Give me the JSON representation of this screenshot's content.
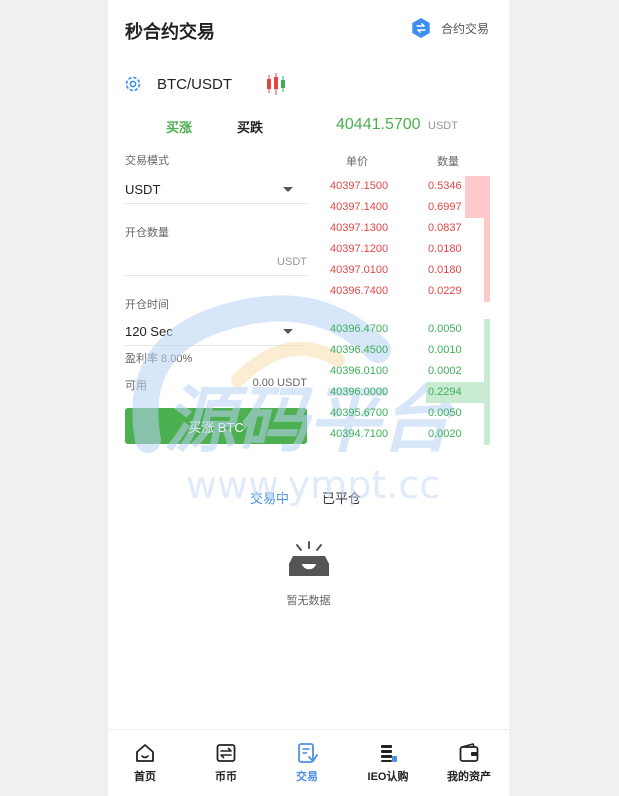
{
  "header": {
    "title": "秒合约交易",
    "contract_link": "合约交易"
  },
  "pair": {
    "name": "BTC/USDT"
  },
  "trade": {
    "tab_up": "买涨",
    "tab_down": "买跌",
    "price": "40441.5700",
    "price_unit": "USDT"
  },
  "form": {
    "mode_label": "交易模式",
    "mode_value": "USDT",
    "qty_label": "开仓数量",
    "qty_unit": "USDT",
    "time_label": "开仓时间",
    "time_value": "120 Sec",
    "profit": "盈利率 8.00%",
    "avail_label": "可用",
    "avail_value": "0.00  USDT",
    "buy_button": "买涨 BTC"
  },
  "orderbook": {
    "price_header": "单价",
    "qty_header": "数量",
    "sells": [
      {
        "price": "40397.1500",
        "qty": "0.5346",
        "depth": 0.39
      },
      {
        "price": "40397.1400",
        "qty": "0.6997",
        "depth": 0.39
      },
      {
        "price": "40397.1300",
        "qty": "0.0837",
        "depth": 0.09
      },
      {
        "price": "40397.1200",
        "qty": "0.0180",
        "depth": 0.09
      },
      {
        "price": "40397.0100",
        "qty": "0.0180",
        "depth": 0.09
      },
      {
        "price": "40396.7400",
        "qty": "0.0229",
        "depth": 0.09
      }
    ],
    "buys": [
      {
        "price": "40396.4700",
        "qty": "0.0050",
        "depth": 0.09
      },
      {
        "price": "40396.4500",
        "qty": "0.0010",
        "depth": 0.09
      },
      {
        "price": "40396.0100",
        "qty": "0.0002",
        "depth": 0.09
      },
      {
        "price": "40396.0000",
        "qty": "0.2294",
        "depth": 1.0
      },
      {
        "price": "40395.6700",
        "qty": "0.0050",
        "depth": 0.09
      },
      {
        "price": "40394.7100",
        "qty": "0.0020",
        "depth": 0.09
      }
    ]
  },
  "orders": {
    "tab_active": "交易中",
    "tab_closed": "已平仓",
    "empty_text": "暂无数据"
  },
  "watermark": {
    "main": "源码平台",
    "url": "www.ympt.cc"
  },
  "nav": [
    {
      "label": "首页",
      "icon": "home-icon"
    },
    {
      "label": "币币",
      "icon": "exchange-icon"
    },
    {
      "label": "交易",
      "icon": "trade-icon"
    },
    {
      "label": "IEO认购",
      "icon": "ieo-icon"
    },
    {
      "label": "我的资产",
      "icon": "wallet-icon"
    }
  ],
  "colors": {
    "up": "#4caf50",
    "down": "#e04848",
    "accent": "#4d8fe6"
  }
}
